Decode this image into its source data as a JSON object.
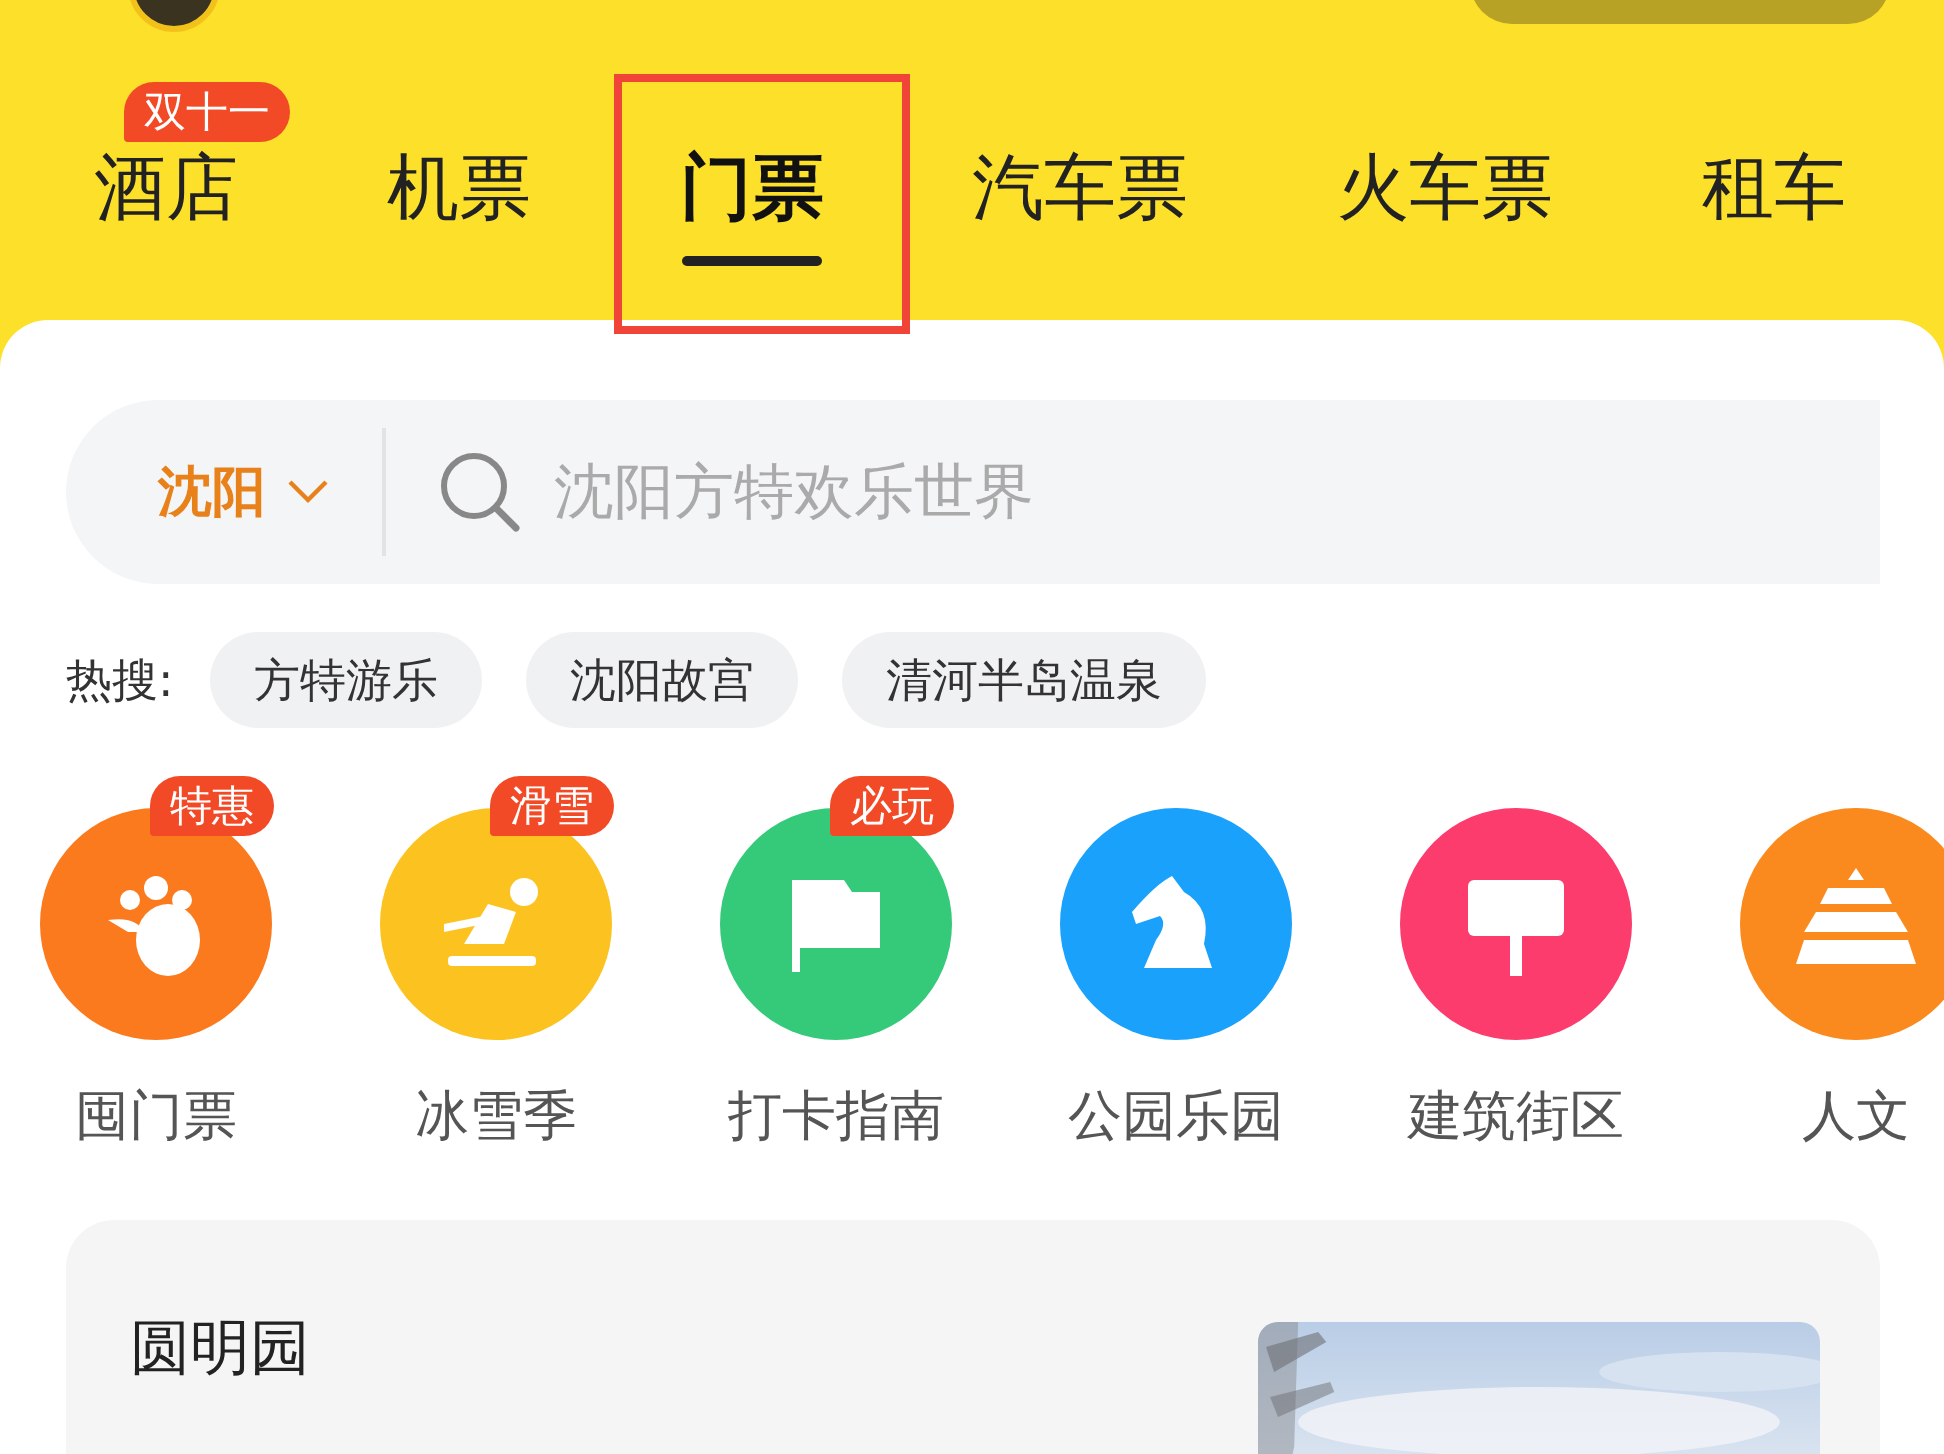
{
  "tabs": [
    {
      "label": "酒店",
      "selected": false,
      "badge": "双十一",
      "highlighted": false
    },
    {
      "label": "机票",
      "selected": false,
      "highlighted": false
    },
    {
      "label": "门票",
      "selected": true,
      "highlighted": true
    },
    {
      "label": "汽车票",
      "selected": false,
      "highlighted": false
    },
    {
      "label": "火车票",
      "selected": false,
      "highlighted": false
    },
    {
      "label": "租车",
      "selected": false,
      "highlighted": false
    }
  ],
  "search": {
    "city": "沈阳",
    "placeholder": "沈阳方特欢乐世界"
  },
  "hot_search": {
    "label": "热搜:",
    "items": [
      "方特游乐",
      "沈阳故宫",
      "清河半岛温泉"
    ]
  },
  "categories": [
    {
      "label": "囤门票",
      "badge": "特惠",
      "color": "#fb7a1e",
      "kind": "paw"
    },
    {
      "label": "冰雪季",
      "badge": "滑雪",
      "color": "#fcc21f",
      "kind": "skier"
    },
    {
      "label": "打卡指南",
      "badge": "必玩",
      "color": "#35c97a",
      "kind": "flag"
    },
    {
      "label": "公园乐园",
      "color": "#1aa1fb",
      "kind": "knight"
    },
    {
      "label": "建筑街区",
      "color": "#fb3c6c",
      "kind": "sign"
    },
    {
      "label": "人文",
      "color": "#fb8a1e",
      "kind": "temple"
    }
  ],
  "feature_card": {
    "title": "圆明园"
  }
}
